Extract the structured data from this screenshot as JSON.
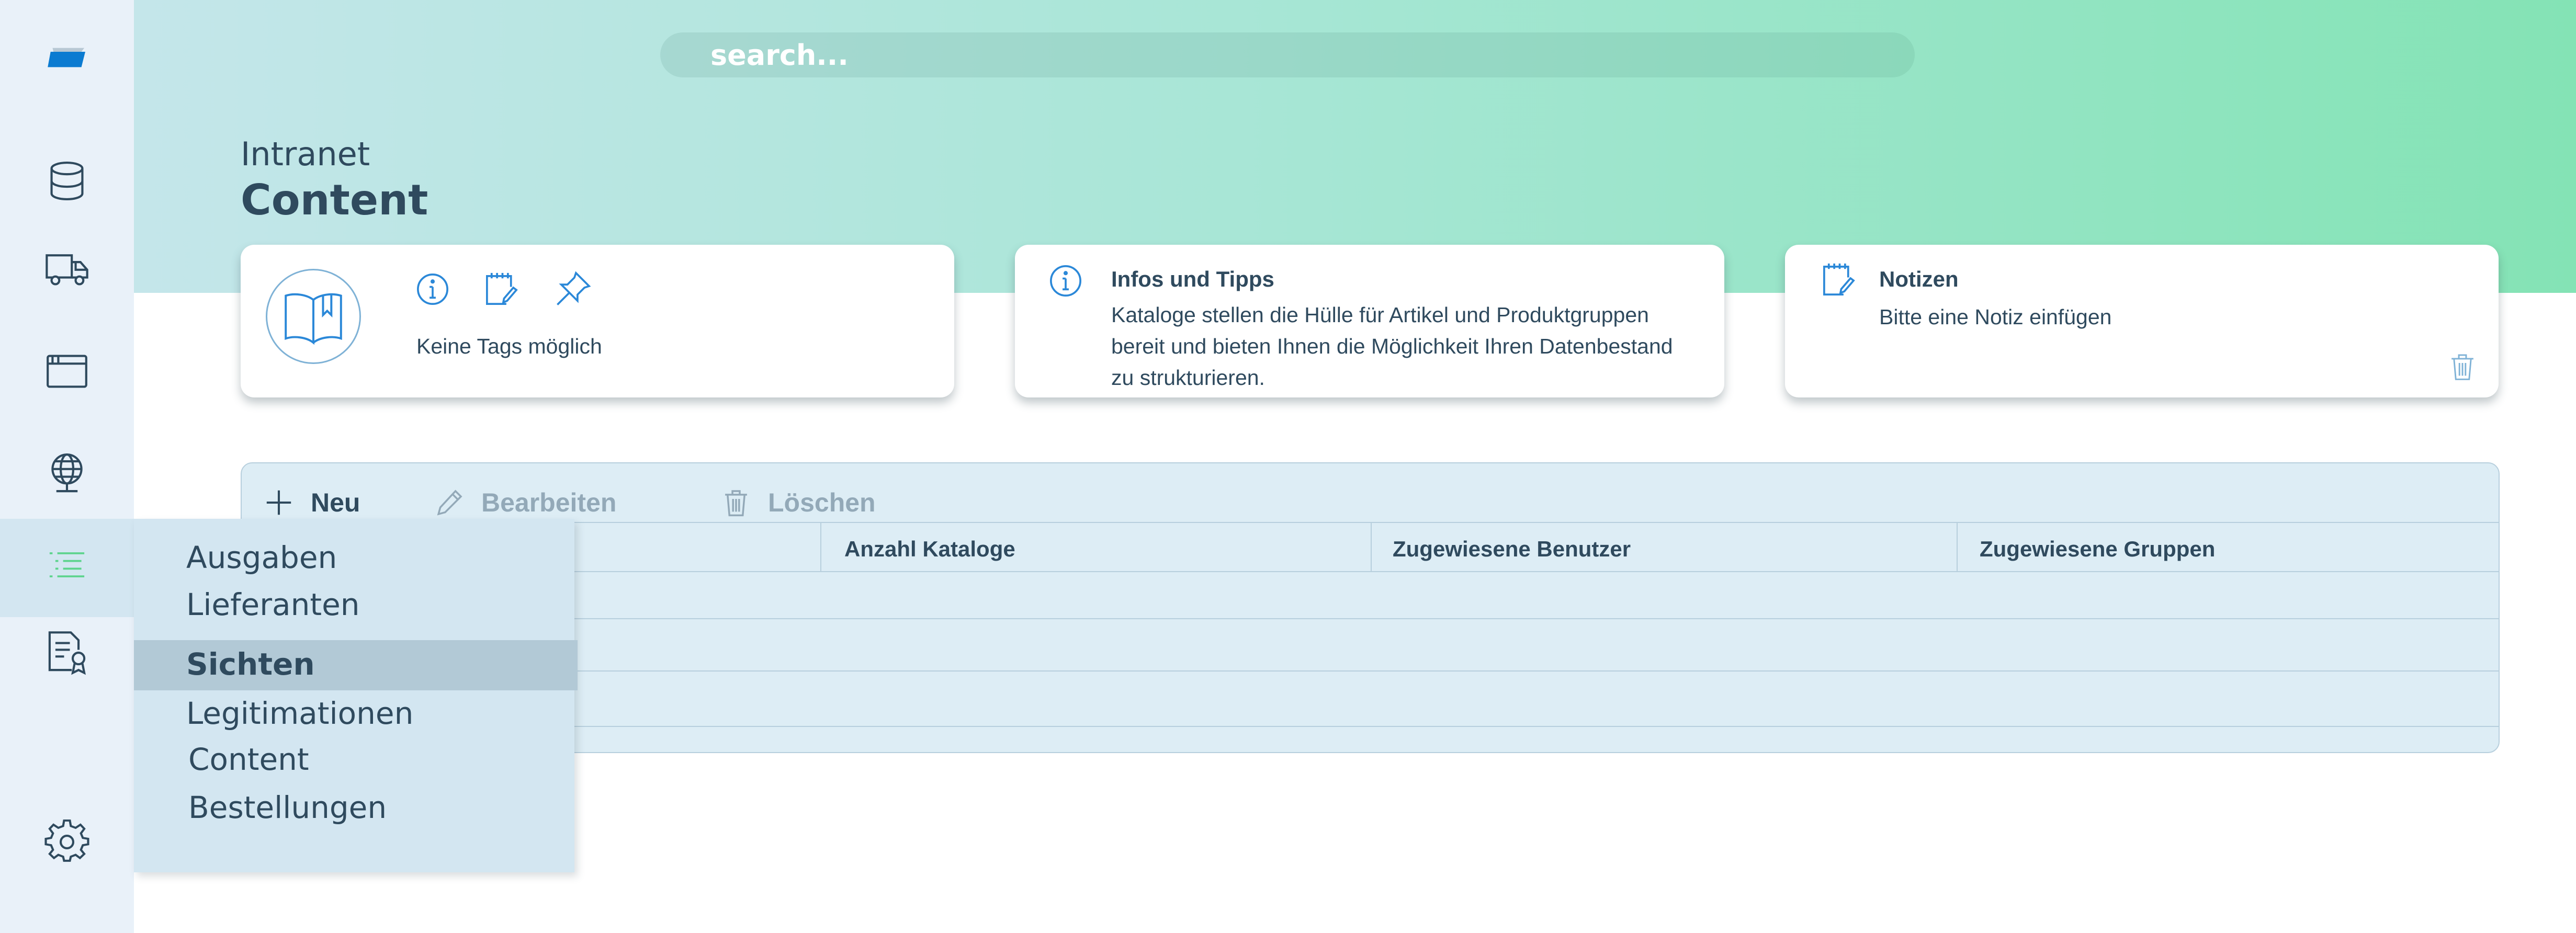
{
  "search": {
    "placeholder": "search..."
  },
  "page": {
    "breadcrumb": "Intranet",
    "title": "Content"
  },
  "sidebar": {
    "items": [
      {
        "icon": "database-icon"
      },
      {
        "icon": "truck-icon"
      },
      {
        "icon": "window-icon"
      },
      {
        "icon": "globe-icon"
      },
      {
        "icon": "list-icon",
        "active": true
      },
      {
        "icon": "certificate-icon"
      },
      {
        "icon": "gear-icon"
      }
    ]
  },
  "cards": {
    "tags": {
      "text": "Keine Tags möglich",
      "icons": [
        "info-icon",
        "notepad-edit-icon",
        "pin-icon"
      ]
    },
    "info": {
      "title": "Infos und Tipps",
      "lines": [
        "Kataloge stellen die Hülle für Artikel und Produktgruppen",
        "bereit und bieten Ihnen die Möglichkeit Ihren Datenbestand",
        "zu strukturieren."
      ]
    },
    "notes": {
      "title": "Notizen",
      "text": "Bitte eine Notiz einfügen"
    }
  },
  "toolbar": {
    "new": "Neu",
    "edit": "Bearbeiten",
    "delete": "Löschen"
  },
  "table": {
    "columns": [
      "Anzahl Kataloge",
      "Zugewiesene Benutzer",
      "Zugewiesene Gruppen"
    ],
    "rows": [
      [],
      [],
      []
    ]
  },
  "menu": {
    "items": [
      "Ausgaben",
      "Lieferanten",
      "Sichten",
      "Legitimationen",
      "Content",
      "Bestellungen"
    ],
    "selected": "Sichten"
  },
  "colors": {
    "accent": "#2b88d8",
    "logo": "#0b7bd1",
    "active_green": "#5cd48c",
    "text": "#2f4a5e",
    "disabled": "#93a9b8"
  }
}
